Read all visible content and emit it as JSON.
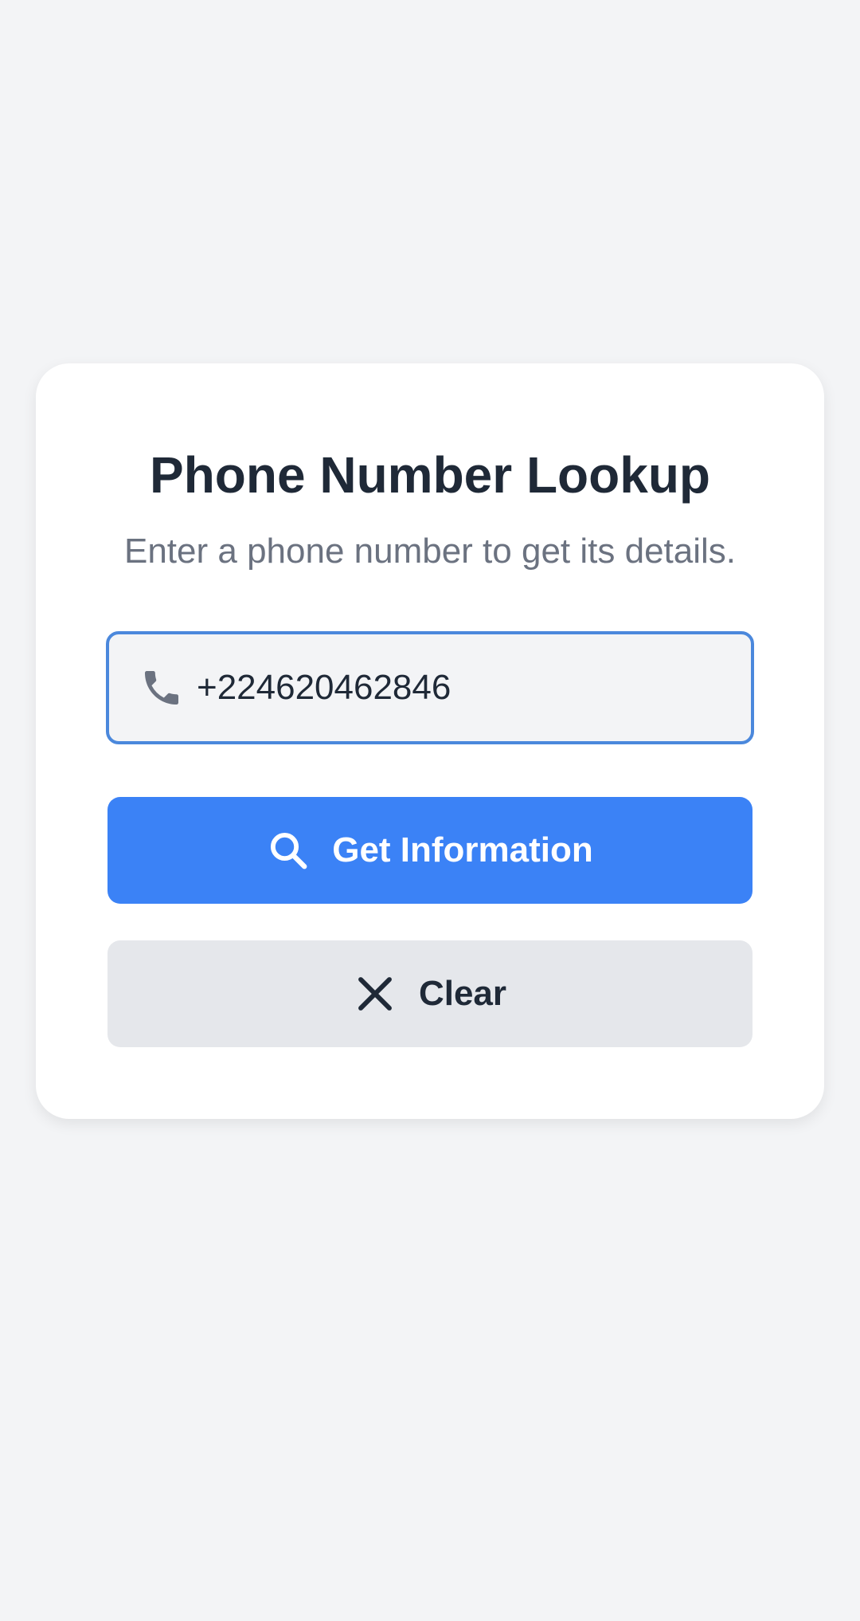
{
  "card": {
    "title": "Phone Number Lookup",
    "subtitle": "Enter a phone number to get its details."
  },
  "phone_field": {
    "value": "+224620462846",
    "icon": "phone-icon"
  },
  "buttons": {
    "get_info": {
      "label": "Get Information",
      "icon": "search-icon"
    },
    "clear": {
      "label": "Clear",
      "icon": "close-icon"
    }
  },
  "colors": {
    "background": "#f3f4f6",
    "primary": "#3b82f6",
    "focus_border": "#4b88dc",
    "text_dark": "#1f2937",
    "text_muted": "#6b7280",
    "secondary_button": "#e5e7eb"
  }
}
